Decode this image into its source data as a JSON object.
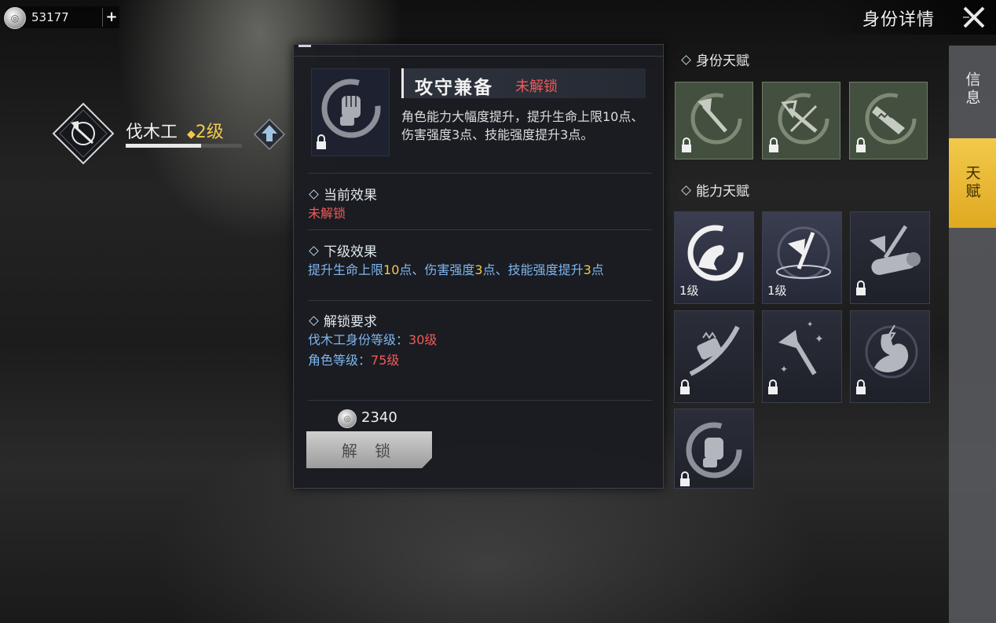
{
  "currency": {
    "amount": "53177",
    "plus_label": "+"
  },
  "header": {
    "title": "身份详情"
  },
  "tabs": {
    "info": "信息",
    "talent": "天赋"
  },
  "identity": {
    "name": "伐木工",
    "level": "2级",
    "level_progress": 0.65
  },
  "detail": {
    "skill_name": "攻守兼备",
    "status": "未解锁",
    "description": "角色能力大幅度提升，提升生命上限10点、伤害强度3点、技能强度提升3点。",
    "current_effect": {
      "title": "当前效果",
      "value": "未解锁"
    },
    "next_effect": {
      "title": "下级效果",
      "p1": "提升生命上限",
      "v1": "10",
      "p2": "点、伤害强度",
      "v2": "3",
      "p3": "点、技能强度提升",
      "v3": "3",
      "p4": "点"
    },
    "requirements": {
      "title": "解锁要求",
      "req1_label": "伐木工身份等级：",
      "req1_value": "30级",
      "req2_label": "角色等级：",
      "req2_value": "75级"
    },
    "cost": "2340",
    "unlock_button": "解 锁"
  },
  "identity_talents": {
    "title": "身份天赋",
    "items": [
      {
        "icon": "axe-icon",
        "locked": true
      },
      {
        "icon": "crossed-axe-icon",
        "locked": true
      },
      {
        "icon": "saw-icon",
        "locked": true
      }
    ]
  },
  "ability_talents": {
    "title": "能力天赋",
    "items": [
      {
        "icon": "flex-arm-icon",
        "level": "1级"
      },
      {
        "icon": "axe-chop-icon",
        "level": "1级"
      },
      {
        "icon": "axe-log-icon",
        "locked": true
      },
      {
        "icon": "chainsaw-icon",
        "locked": true
      },
      {
        "icon": "sparkle-axe-icon",
        "locked": true
      },
      {
        "icon": "stomach-icon",
        "locked": true
      },
      {
        "icon": "fist-icon",
        "locked": true
      }
    ]
  },
  "colors": {
    "accent": "#f2c94c",
    "locked_red": "#ef5a5a",
    "effect_blue": "#7fb6f0",
    "identity_card_green": "#44503f"
  }
}
